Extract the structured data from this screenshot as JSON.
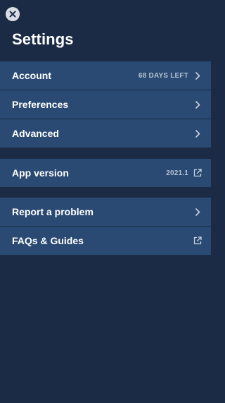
{
  "header": {
    "title": "Settings",
    "close_icon": "close-icon"
  },
  "groups": [
    {
      "items": [
        {
          "label": "Account",
          "meta": "68 DAYS LEFT",
          "icon": "chevron-right-icon"
        },
        {
          "label": "Preferences",
          "meta": "",
          "icon": "chevron-right-icon"
        },
        {
          "label": "Advanced",
          "meta": "",
          "icon": "chevron-right-icon"
        }
      ]
    },
    {
      "items": [
        {
          "label": "App version",
          "meta": "2021.1",
          "icon": "external-link-icon"
        }
      ]
    },
    {
      "items": [
        {
          "label": "Report a problem",
          "meta": "",
          "icon": "chevron-right-icon"
        },
        {
          "label": "FAQs & Guides",
          "meta": "",
          "icon": "external-link-icon"
        }
      ]
    }
  ],
  "colors": {
    "background": "#1b2b45",
    "row": "#2a4a73",
    "meta_text": "#b5c1d1",
    "close_button": "#d9dde3"
  }
}
